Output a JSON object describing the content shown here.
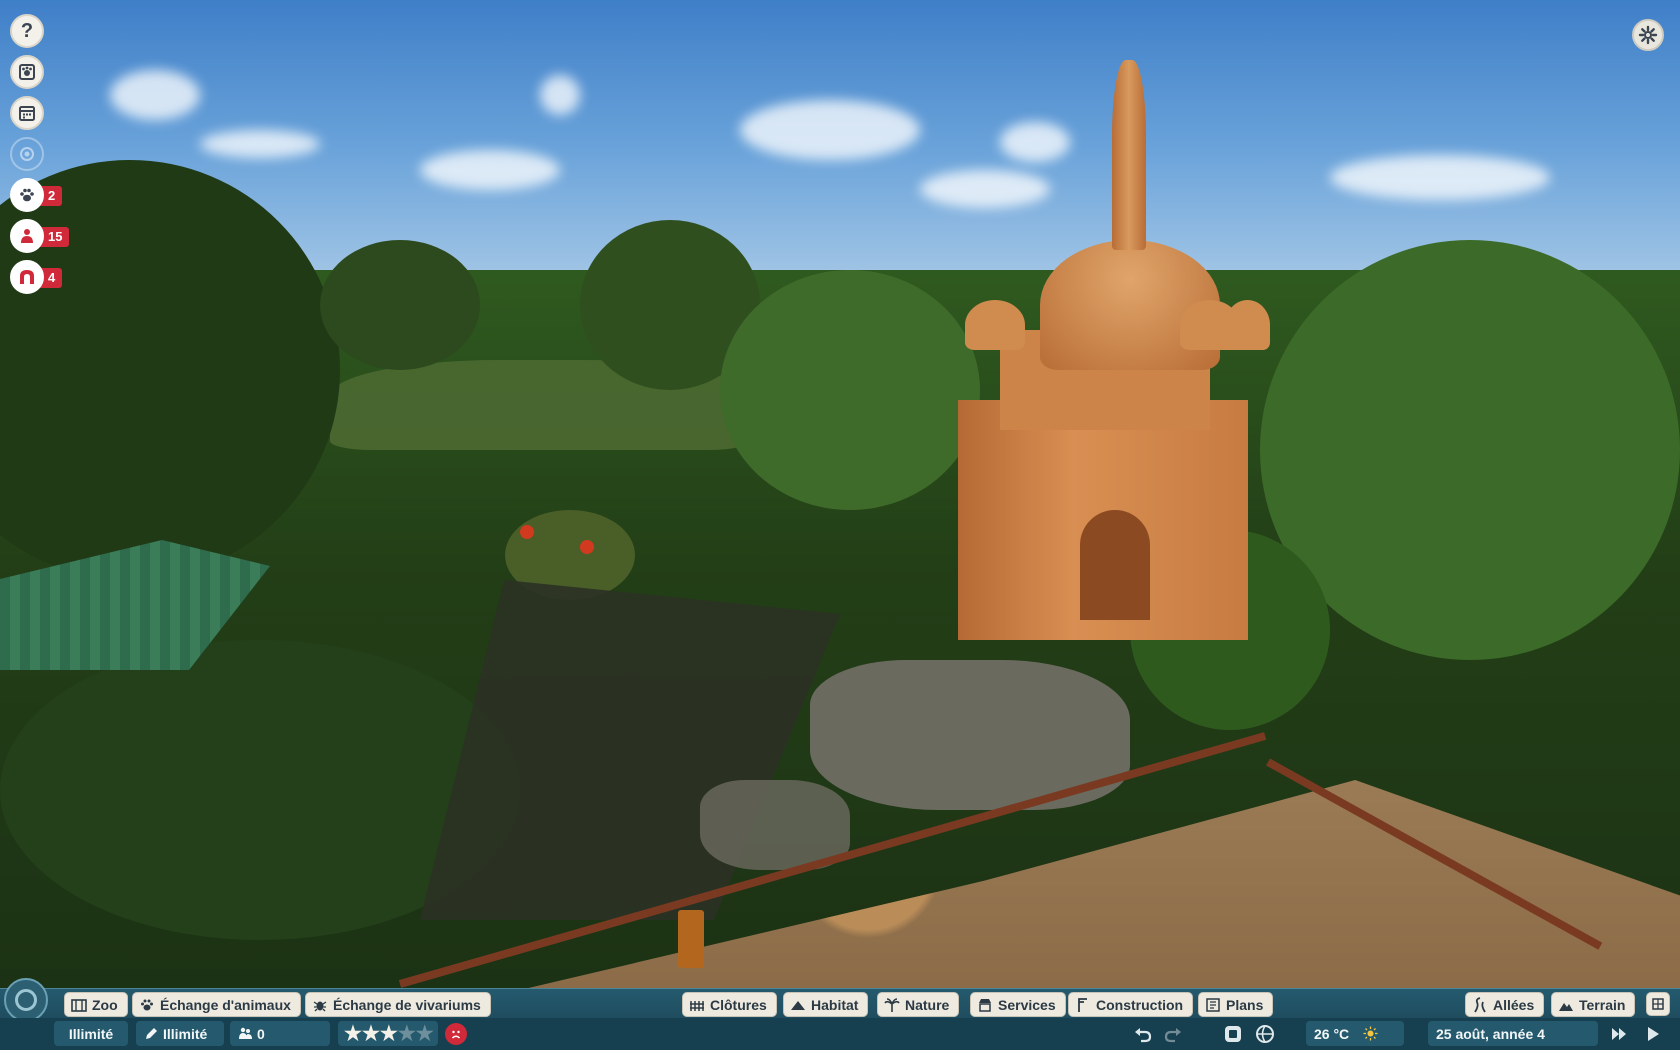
{
  "left_hud": {
    "help_label": "?",
    "animals_count": "2",
    "guests_count": "15",
    "staff_count": "4"
  },
  "toolbar": {
    "zoo": "Zoo",
    "animal_exchange": "Échange d'animaux",
    "vivarium_exchange": "Échange de vivariums",
    "fences": "Clôtures",
    "habitat": "Habitat",
    "nature": "Nature",
    "services": "Services",
    "construction": "Construction",
    "blueprints": "Plans",
    "paths": "Allées",
    "terrain": "Terrain"
  },
  "status": {
    "money": "Illimité",
    "research": "Illimité",
    "guests": "0",
    "rating_stars": 3,
    "rating_max": 5,
    "temperature": "26 °C",
    "date": "25 août, année 4"
  },
  "colors": {
    "bar": "#1c4a5c",
    "badge": "#d02a3a",
    "tab": "#eeeae0"
  }
}
